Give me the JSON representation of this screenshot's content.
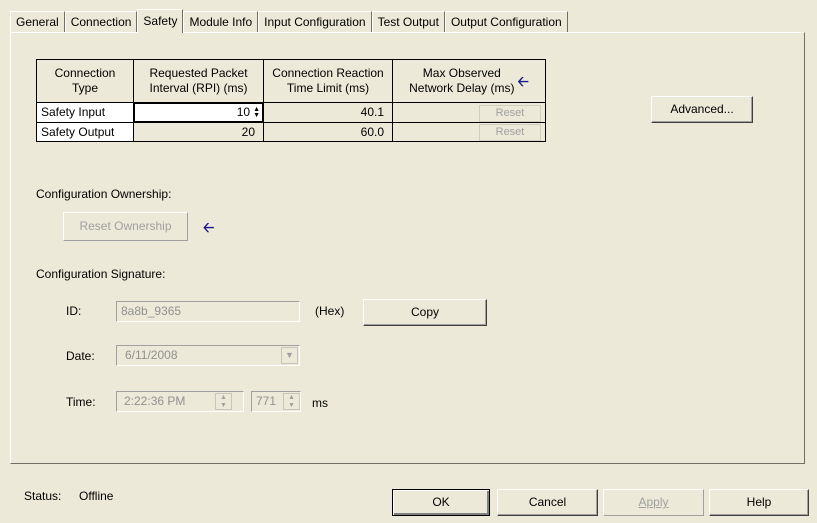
{
  "tabs": [
    "General",
    "Connection",
    "Safety",
    "Module Info",
    "Input Configuration",
    "Test Output",
    "Output Configuration"
  ],
  "active_tab": "Safety",
  "connections_table": {
    "headers": [
      "Connection Type",
      "Requested Packet Interval (RPI) (ms)",
      "Connection Reaction Time Limit (ms)",
      "Max Observed Network Delay (ms)"
    ],
    "header_lines": [
      [
        "Connection",
        "Type"
      ],
      [
        "Requested Packet",
        "Interval (RPI) (ms)"
      ],
      [
        "Connection Reaction",
        "Time Limit (ms)"
      ],
      [
        "Max Observed",
        "Network Delay (ms)"
      ]
    ],
    "rows": [
      {
        "type": "Safety Input",
        "rpi": "10",
        "reaction_limit": "40.1",
        "reset_label": "Reset"
      },
      {
        "type": "Safety Output",
        "rpi": "20",
        "reaction_limit": "60.0",
        "reset_label": "Reset"
      }
    ]
  },
  "advanced_button": "Advanced...",
  "ownership": {
    "label": "Configuration Ownership:",
    "reset_button": "Reset Ownership"
  },
  "signature": {
    "label": "Configuration Signature:",
    "id_label": "ID:",
    "id_value": "8a8b_9365",
    "hex_label": "(Hex)",
    "copy_button": "Copy",
    "date_label": "Date:",
    "date_value": "6/11/2008",
    "time_label": "Time:",
    "time_value": "2:22:36 PM",
    "ms_value": "771",
    "ms_label": "ms"
  },
  "status": {
    "label": "Status:",
    "value": "Offline"
  },
  "buttons": {
    "ok": "OK",
    "cancel": "Cancel",
    "apply": "Apply",
    "help": "Help"
  },
  "icons": {
    "arrow": "left-arrow-icon",
    "arrow_color": "#1a1a8f"
  }
}
